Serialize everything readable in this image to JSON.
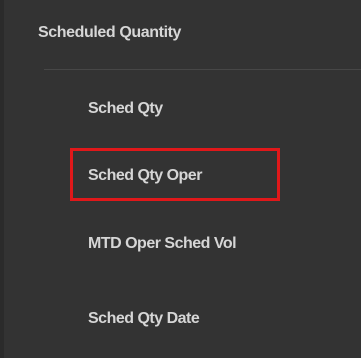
{
  "menu": {
    "group_label": "Scheduled Quantity",
    "items": [
      {
        "label": "Sched Qty"
      },
      {
        "label": "Sched Qty Oper"
      },
      {
        "label": "MTD Oper Sched Vol"
      },
      {
        "label": "Sched Qty Date"
      }
    ]
  },
  "colors": {
    "background": "#333333",
    "text": "#d6d6d6",
    "divider": "#474747",
    "highlight_border": "#e0181a"
  }
}
